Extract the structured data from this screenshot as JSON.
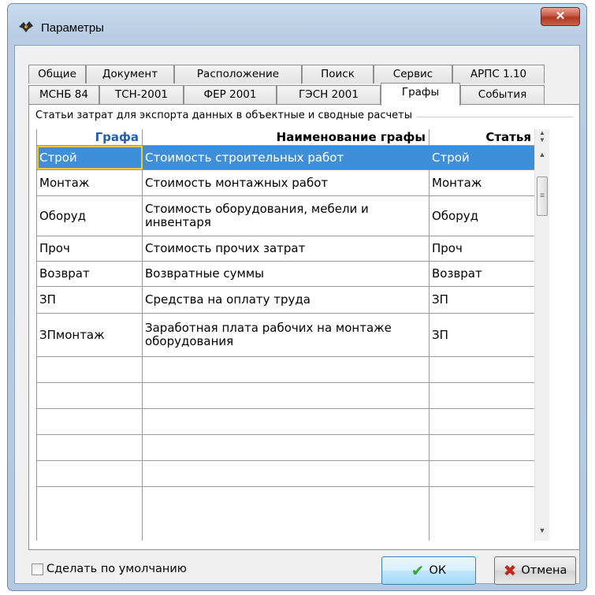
{
  "window": {
    "title": "Параметры"
  },
  "tabs_row1": [
    "Общие",
    "Документ",
    "Расположение",
    "Поиск",
    "Сервис",
    "АРПС 1.10"
  ],
  "tabs_row2": [
    "МСНБ 84",
    "ТСН-2001",
    "ФЕР 2001",
    "ГЭСН 2001",
    "Графы",
    "События"
  ],
  "active_tab": "Графы",
  "group": {
    "title": "Статьи затрат для экспорта данных в объектные и сводные расчеты"
  },
  "grid": {
    "headers": [
      "Графа",
      "Наименование графы",
      "Статья"
    ],
    "rows": [
      [
        "Строй",
        "Стоимость строительных работ",
        "Строй"
      ],
      [
        "Монтаж",
        "Стоимость монтажных работ",
        "Монтаж"
      ],
      [
        "Оборуд",
        "Стоимость оборудования, мебели и инвентаря",
        "Оборуд"
      ],
      [
        "Проч",
        "Стоимость прочих затрат",
        "Проч"
      ],
      [
        "Возврат",
        "Возвратные суммы",
        "Возврат"
      ],
      [
        "ЗП",
        "Средства на оплату труда",
        "ЗП"
      ],
      [
        "ЗПмонтаж",
        "Заработная плата рабочих на монтаже оборудования",
        "ЗП"
      ]
    ],
    "selected_row": 0
  },
  "footer": {
    "default_checkbox_label": "Сделать по умолчанию",
    "default_checked": false,
    "ok_label": "ОК",
    "cancel_label": "Отмена"
  },
  "icons": {
    "app": "app-icon",
    "close": "close-icon",
    "ok": "checkmark-icon",
    "cancel": "cross-icon"
  },
  "colors": {
    "selection": "#3f8fd8",
    "header_accent": "#1f5fb5",
    "close_button": "#c65a44",
    "ok_check": "#3aa63a",
    "cancel_cross": "#c0281e"
  }
}
